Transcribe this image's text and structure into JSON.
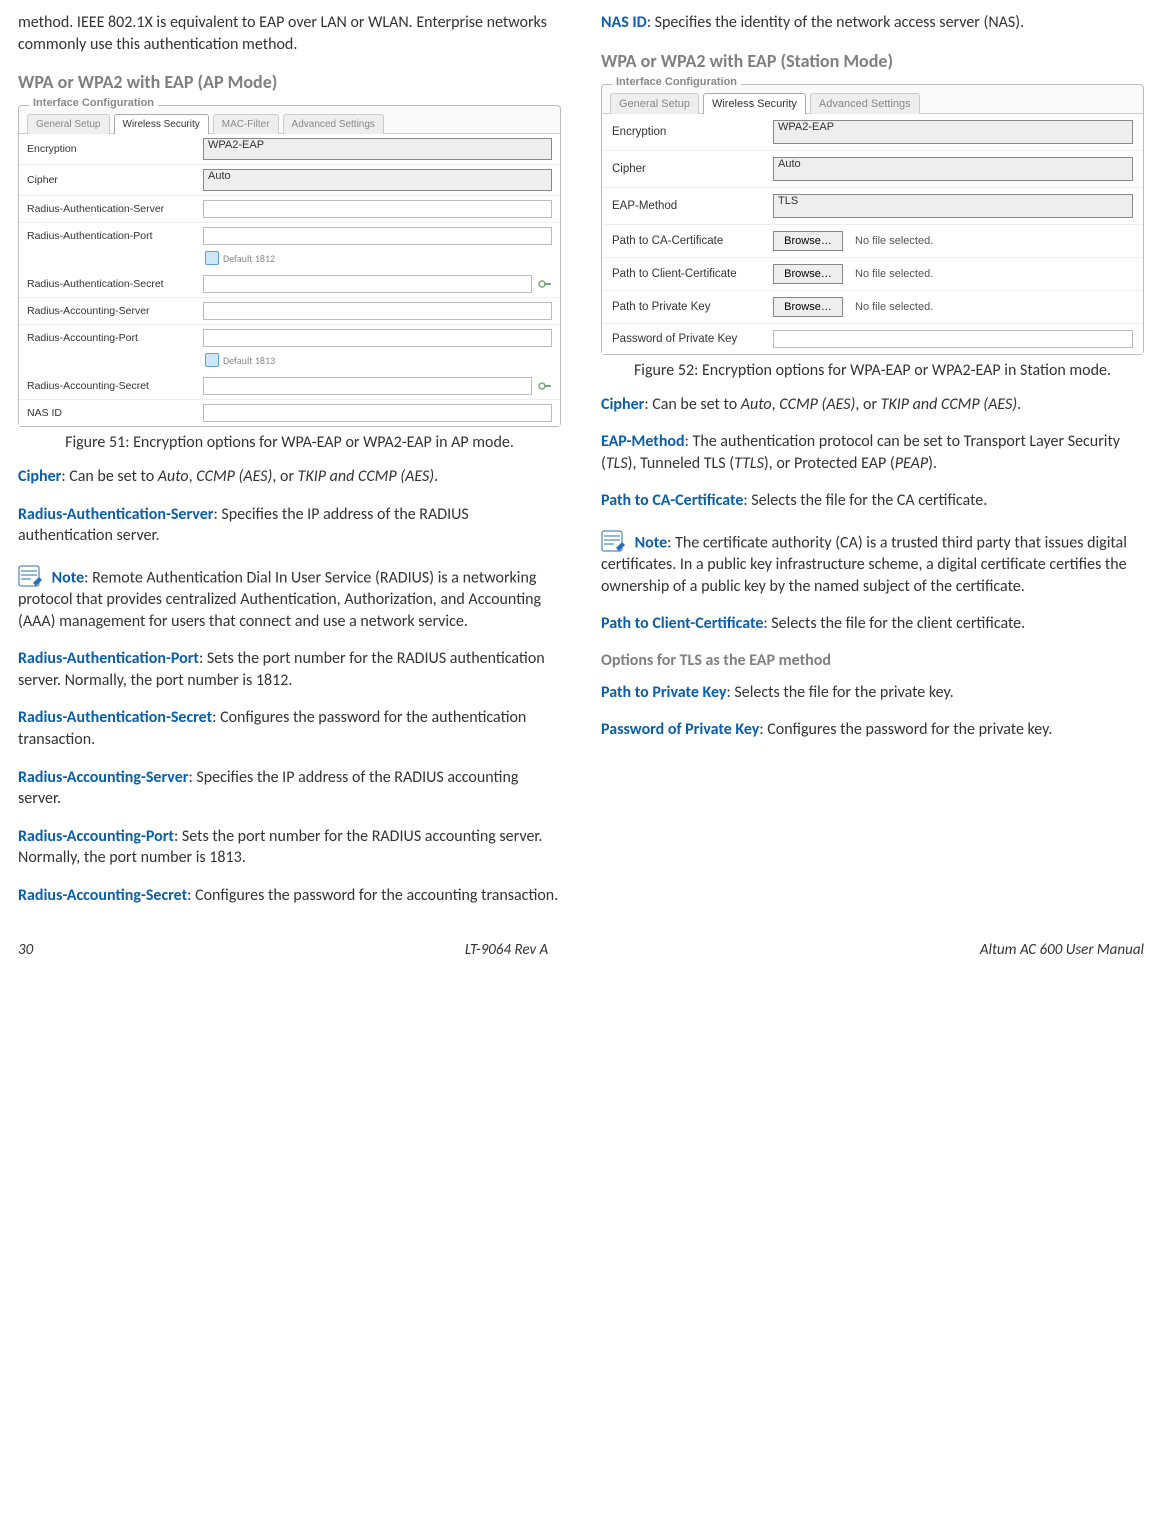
{
  "col1": {
    "intro": "method. IEEE 802.1X is equivalent to EAP over LAN or WLAN. Enterprise networks commonly use this authentication method.",
    "head1": "WPA or WPA2 with EAP (AP Mode)",
    "fig51": {
      "legend": "Interface Configuration",
      "tabs": [
        "General Setup",
        "Wireless Security",
        "MAC-Filter",
        "Advanced Settings"
      ],
      "rows": {
        "encryption": {
          "label": "Encryption",
          "value": "WPA2-EAP"
        },
        "cipher": {
          "label": "Cipher",
          "value": "Auto"
        },
        "ras": {
          "label": "Radius-Authentication-Server"
        },
        "rap": {
          "label": "Radius-Authentication-Port",
          "hint": "Default 1812"
        },
        "rasec": {
          "label": "Radius-Authentication-Secret"
        },
        "racs": {
          "label": "Radius-Accounting-Server"
        },
        "racp": {
          "label": "Radius-Accounting-Port",
          "hint": "Default 1813"
        },
        "racsec": {
          "label": "Radius-Accounting-Secret"
        },
        "nas": {
          "label": "NAS ID"
        }
      },
      "caption": "Figure 51: Encryption options for WPA-EAP or WPA2-EAP in AP mode."
    },
    "defs": {
      "cipher": {
        "term": "Cipher",
        "text": ": Can be set to ",
        "v1": "Auto",
        "sep1": ", ",
        "v2": "CCMP (AES)",
        "sep2": ", or ",
        "v3": "TKIP and CCMP (AES)",
        "end": "."
      },
      "ras": {
        "term": "Radius-Authentication-Server",
        "text": ": Specifies the IP address of the RADIUS authentication server."
      },
      "note": {
        "term": "Note",
        "text": ": Remote Authentication Dial In User Service (RADIUS) is a networking protocol that provides centralized Authentication, Authorization, and Accounting (AAA) management for users that connect and use a network service."
      },
      "rap": {
        "term": "Radius-Authentication-Port",
        "text": ": Sets the port number for the RADIUS authentication server. Normally, the port number is 1812."
      },
      "rasec": {
        "term": "Radius-Authentication-Secret",
        "text": ": Configures the password for the authentication transaction."
      },
      "racs": {
        "term": "Radius-Accounting-Server",
        "text": ": Specifies the IP address of the RADIUS accounting server."
      },
      "racp": {
        "term": "Radius-Accounting-Port",
        "text": ": Sets the port number for the RADIUS accounting server. Normally, the port number is 1813."
      },
      "racsec": {
        "term": "Radius-Accounting-Secret",
        "text": ": Configures the password for the accounting transaction."
      }
    }
  },
  "col2": {
    "nasid": {
      "term": "NAS ID",
      "text": ": Specifies the identity of the network access server (NAS)."
    },
    "head1": "WPA or WPA2 with EAP (Station Mode)",
    "fig52": {
      "legend": "Interface Configuration",
      "tabs": [
        "General Setup",
        "Wireless Security",
        "Advanced Settings"
      ],
      "rows": {
        "encryption": {
          "label": "Encryption",
          "value": "WPA2-EAP"
        },
        "cipher": {
          "label": "Cipher",
          "value": "Auto"
        },
        "eap": {
          "label": "EAP-Method",
          "value": "TLS"
        },
        "cacert": {
          "label": "Path to CA-Certificate",
          "browse": "Browse…",
          "status": "No file selected."
        },
        "clcert": {
          "label": "Path to Client-Certificate",
          "browse": "Browse…",
          "status": "No file selected."
        },
        "pkey": {
          "label": "Path to Private Key",
          "browse": "Browse…",
          "status": "No file selected."
        },
        "ppass": {
          "label": "Password of Private Key"
        }
      },
      "caption": "Figure 52: Encryption options for WPA-EAP or WPA2-EAP in Station mode."
    },
    "defs": {
      "cipher": {
        "term": "Cipher",
        "text": ": Can be set to ",
        "v1": "Auto",
        "sep1": ", ",
        "v2": "CCMP (AES)",
        "sep2": ", or ",
        "v3": "TKIP and CCMP (AES)",
        "end": "."
      },
      "eap": {
        "term": "EAP-Method",
        "text": ": The authentication protocol can be set to Transport Layer Security (",
        "v1": "TLS",
        "mid1": "), Tunneled TLS (",
        "v2": "TTLS",
        "mid2": "), or Protected EAP (",
        "v3": "PEAP",
        "end": ")."
      },
      "cacert": {
        "term": "Path to CA-Certificate",
        "text": ": Selects the file for the CA certificate."
      },
      "note": {
        "term": "Note",
        "text": ": The certificate authority (CA) is a trusted third party that issues digital certificates. In a public key infrastructure scheme, a digital certificate certifies the ownership of a public key by the named subject of the certificate."
      },
      "clcert": {
        "term": "Path to Client-Certificate",
        "text": ": Selects the file for the client certificate."
      },
      "subhead": "Options for TLS as the EAP method",
      "pkey": {
        "term": "Path to Private Key",
        "text": ": Selects the file for the private key."
      },
      "ppass": {
        "term": "Password of Private Key",
        "text": ": Configures the password for the private key."
      }
    }
  },
  "footer": {
    "page": "30",
    "center": "LT-9064 Rev A",
    "right": "Altum AC 600 User Manual"
  }
}
